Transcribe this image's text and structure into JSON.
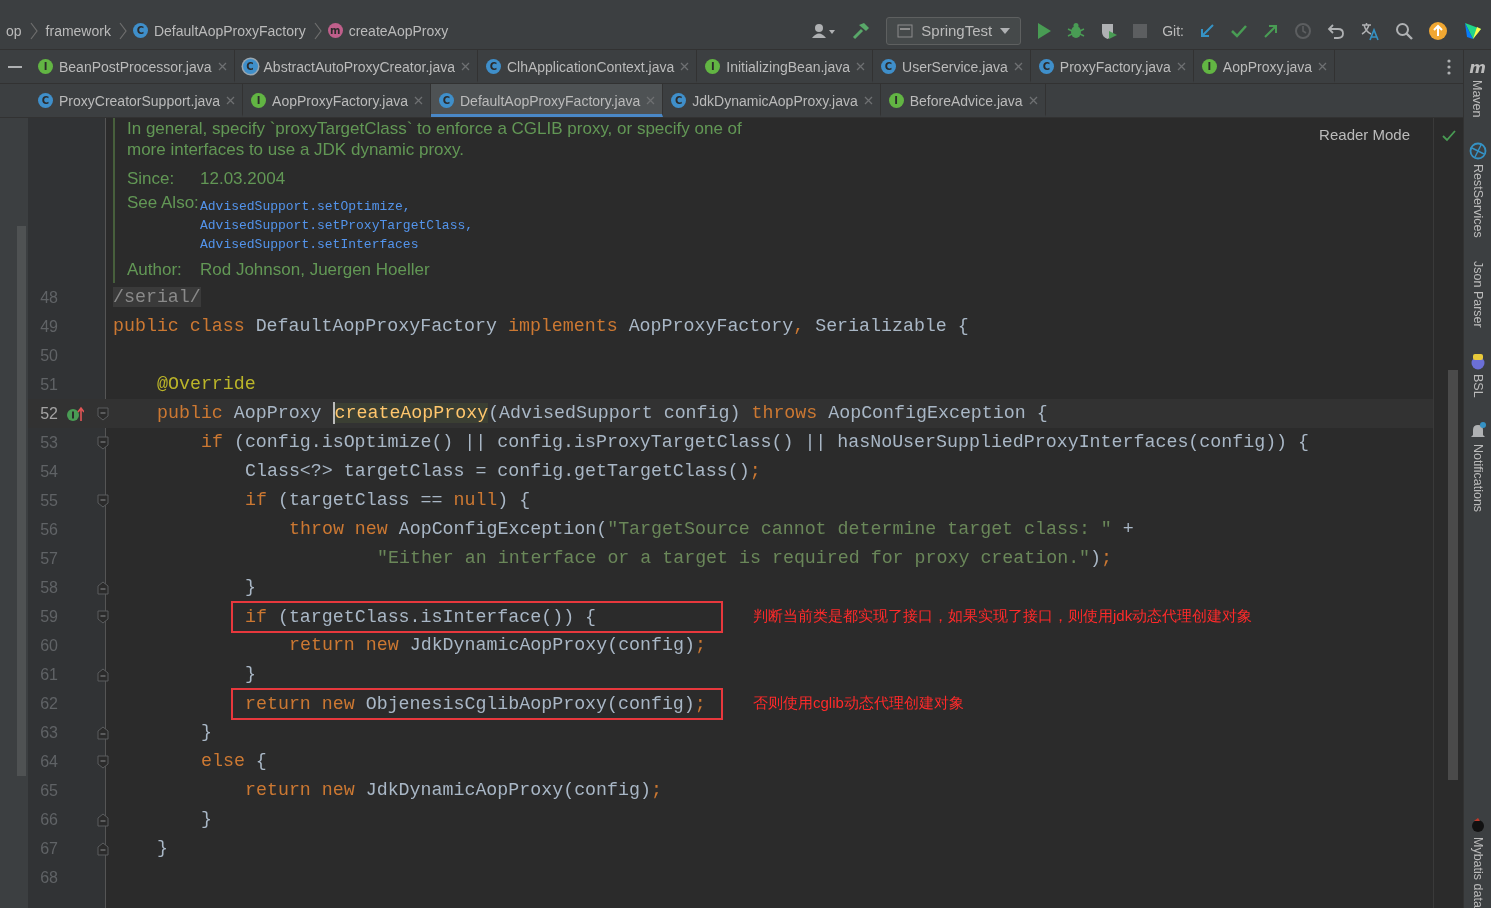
{
  "breadcrumbs": [
    {
      "label": "op"
    },
    {
      "label": "framework"
    },
    {
      "label": "DefaultAopProxyFactory",
      "kind": "class",
      "badge": "C"
    },
    {
      "label": "createAopProxy",
      "kind": "method",
      "badge": "m"
    }
  ],
  "toolbar": {
    "run_config": "SpringTest",
    "vcs_label": "Git:"
  },
  "tab_rows": [
    [
      {
        "label": "BeanPostProcessor.java",
        "kind": "interface",
        "badge": "I",
        "selected": false
      },
      {
        "label": "AbstractAutoProxyCreator.java",
        "kind": "abstract",
        "badge": "C",
        "selected": false
      },
      {
        "label": "ClhApplicationContext.java",
        "kind": "class",
        "badge": "C",
        "selected": false
      },
      {
        "label": "InitializingBean.java",
        "kind": "interface",
        "badge": "I",
        "selected": false
      },
      {
        "label": "UserService.java",
        "kind": "class",
        "badge": "C",
        "selected": false
      },
      {
        "label": "ProxyFactory.java",
        "kind": "class",
        "badge": "C",
        "selected": false
      },
      {
        "label": "AopProxy.java",
        "kind": "interface",
        "badge": "I",
        "selected": false
      }
    ],
    [
      {
        "label": "ProxyCreatorSupport.java",
        "kind": "class",
        "badge": "C",
        "selected": false
      },
      {
        "label": "AopProxyFactory.java",
        "kind": "interface",
        "badge": "I",
        "selected": false
      },
      {
        "label": "DefaultAopProxyFactory.java",
        "kind": "class",
        "badge": "C",
        "selected": true
      },
      {
        "label": "JdkDynamicAopProxy.java",
        "kind": "class",
        "badge": "C",
        "selected": false
      },
      {
        "label": "BeforeAdvice.java",
        "kind": "interface",
        "badge": "I",
        "selected": false
      }
    ]
  ],
  "doc": {
    "paragraph_lines": [
      "In general, specify `proxyTargetClass` to enforce a CGLIB proxy, or specify one of",
      "more interfaces to use a JDK dynamic proxy."
    ],
    "since_label": "Since:",
    "since": "12.03.2004",
    "see_also_label": "See Also:",
    "see_also": [
      "AdvisedSupport.setOptimize,",
      "AdvisedSupport.setProxyTargetClass,",
      "AdvisedSupport.setInterfaces"
    ],
    "author_label": "Author:",
    "author": "Rod Johnson, Juergen Hoeller"
  },
  "reader_mode": "Reader Mode",
  "lines": [
    {
      "num": "48",
      "tokens": [
        {
          "kind": "folded",
          "text": "/serial/"
        }
      ]
    },
    {
      "num": "49",
      "tokens": [
        {
          "kind": "kw",
          "text": "public class "
        },
        {
          "kind": "plain",
          "text": "DefaultAopProxyFactory "
        },
        {
          "kind": "kw",
          "text": "implements "
        },
        {
          "kind": "plain",
          "text": "AopProxyFactory"
        },
        {
          "kind": "kw",
          "text": ", "
        },
        {
          "kind": "plain",
          "text": "Serializable {"
        }
      ],
      "children": [
        {
          "num": "50"
        },
        {
          "num": "51",
          "tokens": [
            {
              "kind": "ann",
              "text": "@Override"
            }
          ]
        },
        {
          "num": "52",
          "current": true,
          "gutter": [
            {
              "kind": "implements"
            },
            {
              "kind": "fold_start"
            }
          ],
          "tokens": [
            {
              "kind": "kw",
              "text": "public "
            },
            {
              "kind": "plain",
              "text": "AopProxy "
            },
            {
              "kind": "decl",
              "text": "createAopProxy"
            },
            {
              "kind": "plain",
              "text": "(AdvisedSupport config) "
            },
            {
              "kind": "kw",
              "text": "throws "
            },
            {
              "kind": "plain",
              "text": "AopConfigException {"
            }
          ],
          "children": [
            {
              "num": "53",
              "gutter": [
                {
                  "kind": "fold_start"
                }
              ],
              "tokens": [
                {
                  "kind": "kw",
                  "text": "if "
                },
                {
                  "kind": "plain",
                  "text": "(config.isOptimize() || config.isProxyTargetClass() || hasNoUserSuppliedProxyInterfaces(config)) {"
                }
              ],
              "children": [
                {
                  "num": "54",
                  "tokens": [
                    {
                      "kind": "plain",
                      "text": "Class<?> targetClass = config.getTargetClass()"
                    },
                    {
                      "kind": "kw",
                      "text": ";"
                    }
                  ]
                },
                {
                  "num": "55",
                  "gutter": [
                    {
                      "kind": "fold_start"
                    }
                  ],
                  "tokens": [
                    {
                      "kind": "kw",
                      "text": "if "
                    },
                    {
                      "kind": "plain",
                      "text": "(targetClass == "
                    },
                    {
                      "kind": "kw",
                      "text": "null"
                    },
                    {
                      "kind": "plain",
                      "text": ") {"
                    }
                  ],
                  "children": [
                    {
                      "num": "56",
                      "tokens": [
                        {
                          "kind": "kw",
                          "text": "throw new "
                        },
                        {
                          "kind": "plain",
                          "text": "AopConfigException("
                        },
                        {
                          "kind": "str",
                          "text": "\"TargetSource cannot determine target class: \" "
                        },
                        {
                          "kind": "plain",
                          "text": "+"
                        }
                      ],
                      "children": [
                        {
                          "num": "57",
                          "kind": "continuation",
                          "tokens": [
                            {
                              "kind": "str",
                              "text": "\"Either an interface or a target is required for proxy creation.\""
                            },
                            {
                              "kind": "plain",
                              "text": ")"
                            },
                            {
                              "kind": "kw",
                              "text": ";"
                            }
                          ]
                        }
                      ]
                    }
                  ]
                },
                {
                  "num": "58",
                  "gutter": [
                    {
                      "kind": "fold_end"
                    }
                  ],
                  "tokens": [
                    {
                      "kind": "plain",
                      "text": "}"
                    }
                  ]
                },
                {
                  "num": "59",
                  "gutter": [
                    {
                      "kind": "fold_start"
                    }
                  ],
                  "note": "判断当前类是都实现了接口，如果实现了接口，则使用jdk动态代理创建对象",
                  "tokens": [
                    {
                      "kind": "kw",
                      "text": "if "
                    },
                    {
                      "kind": "plain",
                      "text": "(targetClass.isInterface()) {"
                    }
                  ],
                  "children": [
                    {
                      "num": "60",
                      "tokens": [
                        {
                          "kind": "kw",
                          "text": "return new "
                        },
                        {
                          "kind": "plain",
                          "text": "JdkDynamicAopProxy(config)"
                        },
                        {
                          "kind": "kw",
                          "text": ";"
                        }
                      ]
                    }
                  ]
                },
                {
                  "num": "61",
                  "gutter": [
                    {
                      "kind": "fold_end"
                    }
                  ],
                  "tokens": [
                    {
                      "kind": "plain",
                      "text": "}"
                    }
                  ]
                },
                {
                  "num": "62",
                  "note": "否则使用cglib动态代理创建对象",
                  "tokens": [
                    {
                      "kind": "kw",
                      "text": "return new "
                    },
                    {
                      "kind": "plain",
                      "text": "ObjenesisCglibAopProxy(config)"
                    },
                    {
                      "kind": "kw",
                      "text": ";"
                    }
                  ]
                }
              ]
            },
            {
              "num": "63",
              "gutter": [
                {
                  "kind": "fold_end"
                }
              ],
              "tokens": [
                {
                  "kind": "plain",
                  "text": "}"
                }
              ]
            },
            {
              "num": "64",
              "gutter": [
                {
                  "kind": "fold_start"
                }
              ],
              "tokens": [
                {
                  "kind": "kw",
                  "text": "else "
                },
                {
                  "kind": "plain",
                  "text": "{"
                }
              ],
              "children": [
                {
                  "num": "65",
                  "tokens": [
                    {
                      "kind": "kw",
                      "text": "return new "
                    },
                    {
                      "kind": "plain",
                      "text": "JdkDynamicAopProxy(config)"
                    },
                    {
                      "kind": "kw",
                      "text": ";"
                    }
                  ]
                }
              ]
            },
            {
              "num": "66",
              "gutter": [
                {
                  "kind": "fold_end"
                }
              ],
              "tokens": [
                {
                  "kind": "plain",
                  "text": "}"
                }
              ]
            }
          ]
        },
        {
          "num": "67",
          "gutter": [
            {
              "kind": "fold_end"
            }
          ],
          "tokens": [
            {
              "kind": "plain",
              "text": "}"
            }
          ]
        }
      ]
    },
    {
      "num": "68"
    }
  ],
  "sidebar": [
    {
      "label": "Maven",
      "kind": "maven",
      "icon_text": "m"
    },
    {
      "label": "RestServices",
      "kind": "rest"
    },
    {
      "label": "Json Parser",
      "kind": "plain"
    },
    {
      "label": "BSL",
      "kind": "bsl"
    },
    {
      "label": "Notifications",
      "kind": "bell"
    },
    {
      "label": "Mybatis data",
      "kind": "mybatis"
    }
  ]
}
